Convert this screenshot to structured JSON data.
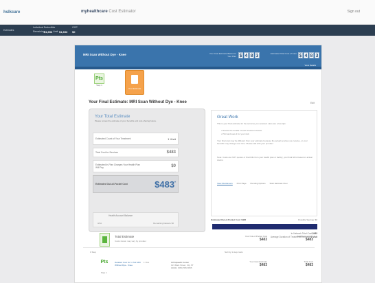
{
  "header": {
    "brand_left": "hslkcare",
    "brand_center_bold": "myhealthcare",
    "brand_center_rest": "Cost Estimator",
    "signout": "Sign out"
  },
  "infobar": {
    "item1": "Estimates",
    "deductible_label": "Individual Deductible",
    "remaining_label": "Remaining",
    "remaining_value": "$1,653",
    "limit_label": "Limit",
    "limit_value": "$1,653",
    "oop_label": "OOP",
    "oop_value": "$0"
  },
  "card": {
    "title": "MRI Scan Without Dye - Knee",
    "odo1_label": "Your Cost Estimate Based on Your Plan",
    "odo1_digits": [
      "$",
      "4",
      "8",
      "3"
    ],
    "odo2_label": "Estimated Total Cost of Care",
    "odo2_digits": [
      "$",
      "4",
      "8",
      "3"
    ],
    "detail_link": "View Details",
    "step1_label": "Step 1",
    "step1_icon": "Pts",
    "step2_label": "Your Estimate",
    "final_title": "Your Final Estimate:   MRI Scan Without Dye - Knee",
    "edit_link": "Edit"
  },
  "estimate": {
    "heading": "Your Total Estimate",
    "sub": "Please review the estimate of your benefits and cost-sharing below.",
    "rows": [
      {
        "label": "Estimated Count of Your Treatment",
        "value": "1 Visit"
      },
      {
        "label": "Total Cost for Services",
        "value": "$483"
      },
      {
        "label": "Estimated In-Plan Charges Your Health Plan Will Pay",
        "value": "$0"
      }
    ],
    "total_label": "Estimated Out-of-Pocket Cost",
    "total_value": "$483",
    "total_suffix": "*",
    "hsa_heading": "Health Account Balance",
    "hsa_left": "HSA",
    "hsa_right": "Remaining balance $0"
  },
  "great_work": {
    "heading": "Great Work",
    "p1": "This is your final estimate for the services you selected. Here are a few tips:",
    "p2": "• Review the details of each treatment below.",
    "p3": "• Print and save it for your visit.",
    "p4": "Your final cost may be different from your estimate because the actual services you receive, or your benefits may change over time. Please talk with your provider.",
    "p5": "Note: Costs are NOT quotes or final bills from your health plan or facility; your final bill is based on actual claims.",
    "link1": "View Disclaimers",
    "link2": "Print Page",
    "link3": "Pending Options",
    "link4": "Start Estimate Over"
  },
  "savings": {
    "label": "Estimated Out-of-Pocket Cost: $483",
    "right": "Possible Savings: $0"
  },
  "averages": {
    "line1_label": "In-Network Total Cost",
    "line1_value": "$483",
    "line2_label": "Average Duration of Treatment/Recovery",
    "line2_value": "1 Visit"
  },
  "total_estimate": {
    "title": "Total Estimate",
    "sub": "Costs shown may vary by provider",
    "col1_label": "Your Out-of-Pocket Cost",
    "col1_value": "$483",
    "col2_label": "Total Cost of Care",
    "col2_value": "$483",
    "step_label": "1 Step",
    "sort_label": "Sort by 1 step costs",
    "pts_icon": "Pts",
    "pts_label": "Step 1",
    "prov_a": "Detailed Cost for 1 Visit MRI Without Dye - Knee",
    "prov_b": "1 Visit",
    "prov_c_name": "Orthopaedic Center",
    "prov_c_addr": "123 Main Street, City ST 00000, (555) 555-5555",
    "prov_cost1_label": "Your Cost Estimate",
    "prov_cost1_value": "$483",
    "prov_cost2_label": "Total Cost",
    "prov_cost2_value": "$483"
  }
}
